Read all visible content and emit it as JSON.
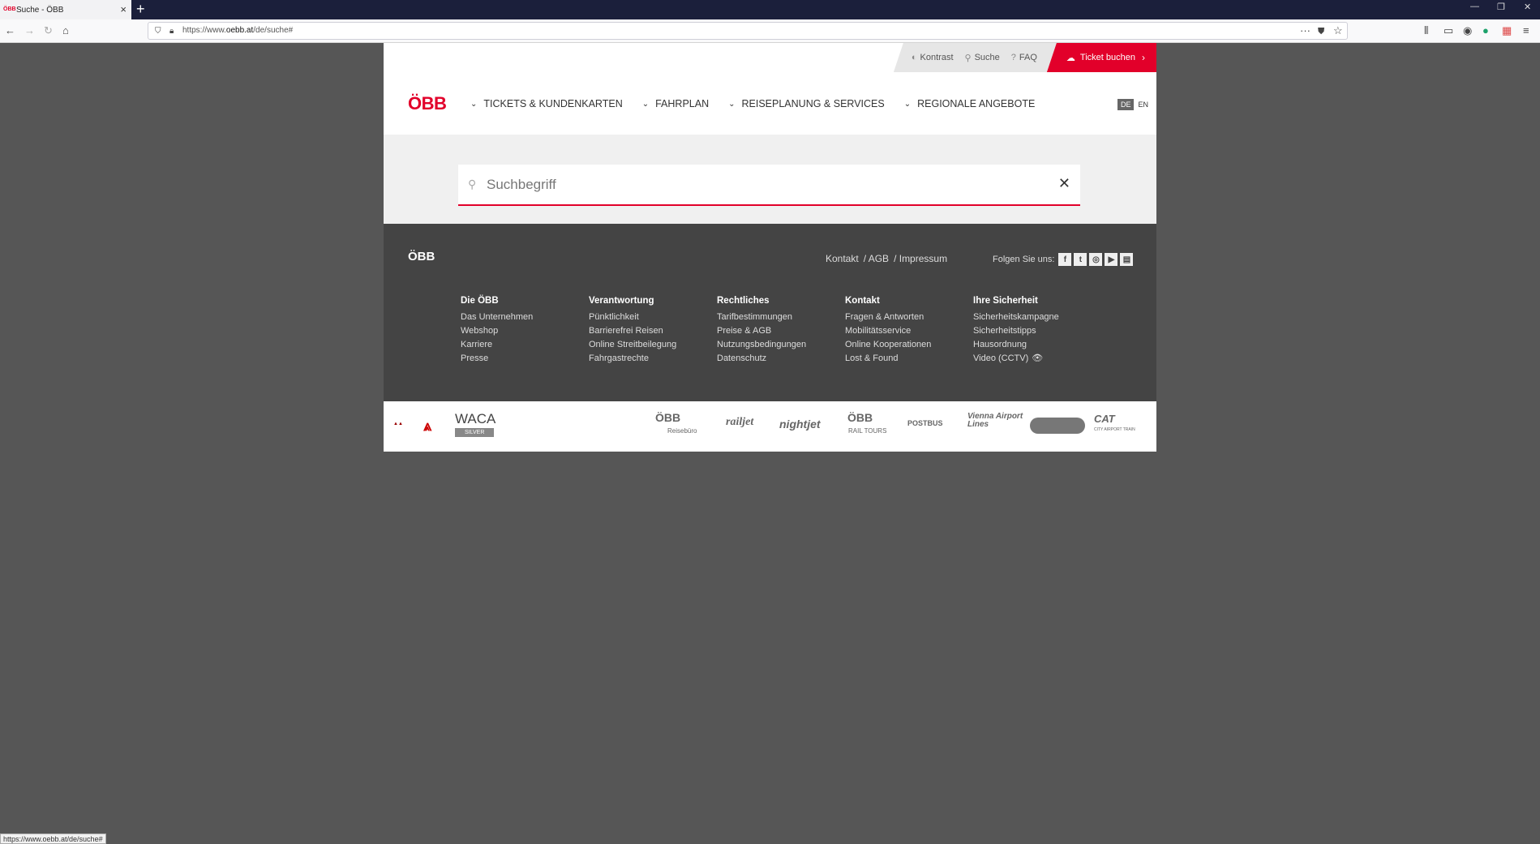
{
  "browser": {
    "tab_title": "Suche - ÖBB",
    "tab_favicon": "ÖBB",
    "url_prefix": "https://www.",
    "url_domain": "oebb.at",
    "url_path": "/de/suche#",
    "status_url": "https://www.oebb.at/de/suche#"
  },
  "utility": {
    "kontrast": "Kontrast",
    "suche": "Suche",
    "faq": "FAQ",
    "ticket": "Ticket buchen"
  },
  "header": {
    "logo": "ÖBB",
    "menu": [
      {
        "label": "TICKETS & KUNDENKARTEN"
      },
      {
        "label": "FAHRPLAN"
      },
      {
        "label": "REISEPLANUNG & SERVICES"
      },
      {
        "label": "REGIONALE ANGEBOTE"
      }
    ],
    "lang_de": "DE",
    "lang_en": "EN"
  },
  "search": {
    "placeholder": "Suchbegriff",
    "value": ""
  },
  "footer": {
    "logo": "ÖBB",
    "links": [
      "Kontakt",
      "/ AGB",
      "/ Impressum"
    ],
    "follow": "Folgen Sie uns:",
    "columns": [
      {
        "title": "Die ÖBB",
        "items": [
          "Das Unternehmen",
          "Webshop",
          "Karriere",
          "Presse"
        ]
      },
      {
        "title": "Verantwortung",
        "items": [
          "Pünktlichkeit",
          "Barrierefrei Reisen",
          "Online Streitbeilegung",
          "Fahrgastrechte"
        ]
      },
      {
        "title": "Rechtliches",
        "items": [
          "Tarifbestimmungen",
          "Preise & AGB",
          "Nutzungsbedingungen",
          "Datenschutz"
        ]
      },
      {
        "title": "Kontakt",
        "items": [
          "Fragen & Antworten",
          "Mobilitätsservice",
          "Online Kooperationen",
          "Lost & Found"
        ]
      },
      {
        "title": "Ihre Sicherheit",
        "items": [
          "Sicherheitskampagne",
          "Sicherheitstipps",
          "Hausordnung",
          "Video (CCTV)"
        ]
      }
    ]
  },
  "partners": {
    "waca": "WACA",
    "waca_silver": "SILVER",
    "reisebuero": "ÖBB",
    "reisebuero_sub": "Reisebüro",
    "railjet": "railjet",
    "nightjet": "nightjet",
    "railtours": "ÖBB",
    "railtours_sub": "RAIL TOURS",
    "postbus": "POSTBUS",
    "vienna": "Vienna Airport Lines",
    "cat": "CAT",
    "cat_sub": "CITY AIRPORT TRAIN"
  }
}
